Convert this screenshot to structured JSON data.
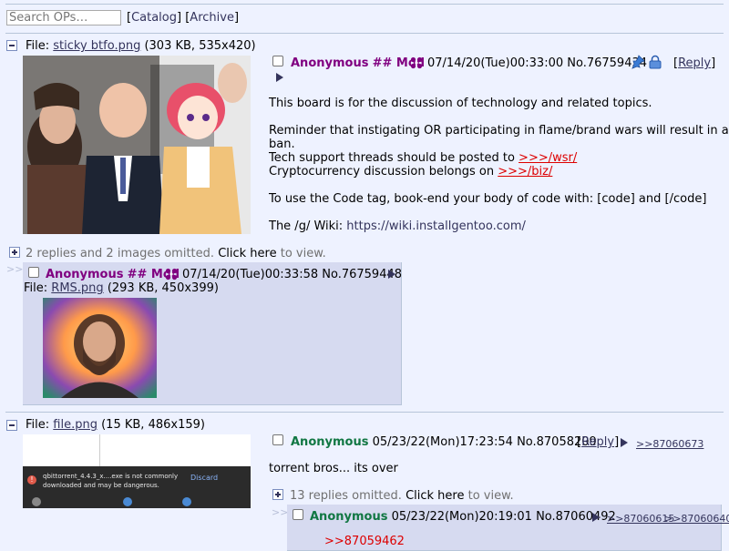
{
  "search": {
    "placeholder": "Search OPs…"
  },
  "nav": {
    "catalog": "Catalog",
    "archive": "Archive"
  },
  "thread1": {
    "file_label": "File:",
    "file_name": "sticky btfo.png",
    "file_info": "(303 KB, 535x420)",
    "name": "Anonymous",
    "capcode": "## Mod",
    "datetime": "07/14/20(Tue)00:33:00",
    "post_no": "No.76759434",
    "reply_link": "Reply",
    "lines": [
      "This board is for the discussion of technology and related topics.",
      "Reminder that instigating OR participating in flame/brand wars will result in a",
      "ban.",
      "Tech support threads should be posted to ",
      "Cryptocurrency discussion belongs on ",
      "To use the Code tag, book-end your body of code with: [code] and [/code]",
      "The /g/ Wiki: "
    ],
    "wsr_link": ">>>/wsr/",
    "biz_link": ">>>/biz/",
    "wiki_link": "https://wiki.installgentoo.com/",
    "omitted_text": "2 replies and 2 images omitted.",
    "click_here": "Click here",
    "to_view": "to view."
  },
  "reply1": {
    "name": "Anonymous",
    "capcode": "## Mod",
    "datetime": "07/14/20(Tue)00:33:58",
    "post_no": "No.76759448",
    "file_label": "File:",
    "file_name": "RMS.png",
    "file_info": "(293 KB, 450x399)"
  },
  "thread2": {
    "file_label": "File:",
    "file_name": "file.png",
    "file_info": "(15 KB, 486x159)",
    "thumb_text": "qbittorrent_4.4.3_x....exe is not commonly downloaded and may be dangerous.",
    "thumb_button": "Discard",
    "name": "Anonymous",
    "datetime": "05/23/22(Mon)17:23:54",
    "post_no": "No.87058209",
    "reply_link": "Reply",
    "backlink": ">>87060673",
    "comment": "torrent bros... its over",
    "omitted_text": "13 replies omitted.",
    "click_here": "Click here",
    "to_view": "to view."
  },
  "reply2": {
    "name": "Anonymous",
    "datetime": "05/23/22(Mon)20:19:01",
    "post_no": "No.87060492",
    "backlinks": [
      ">>87060615",
      ">>87060640"
    ],
    "quote": ">>87059462"
  },
  "side_arrows": ">>"
}
